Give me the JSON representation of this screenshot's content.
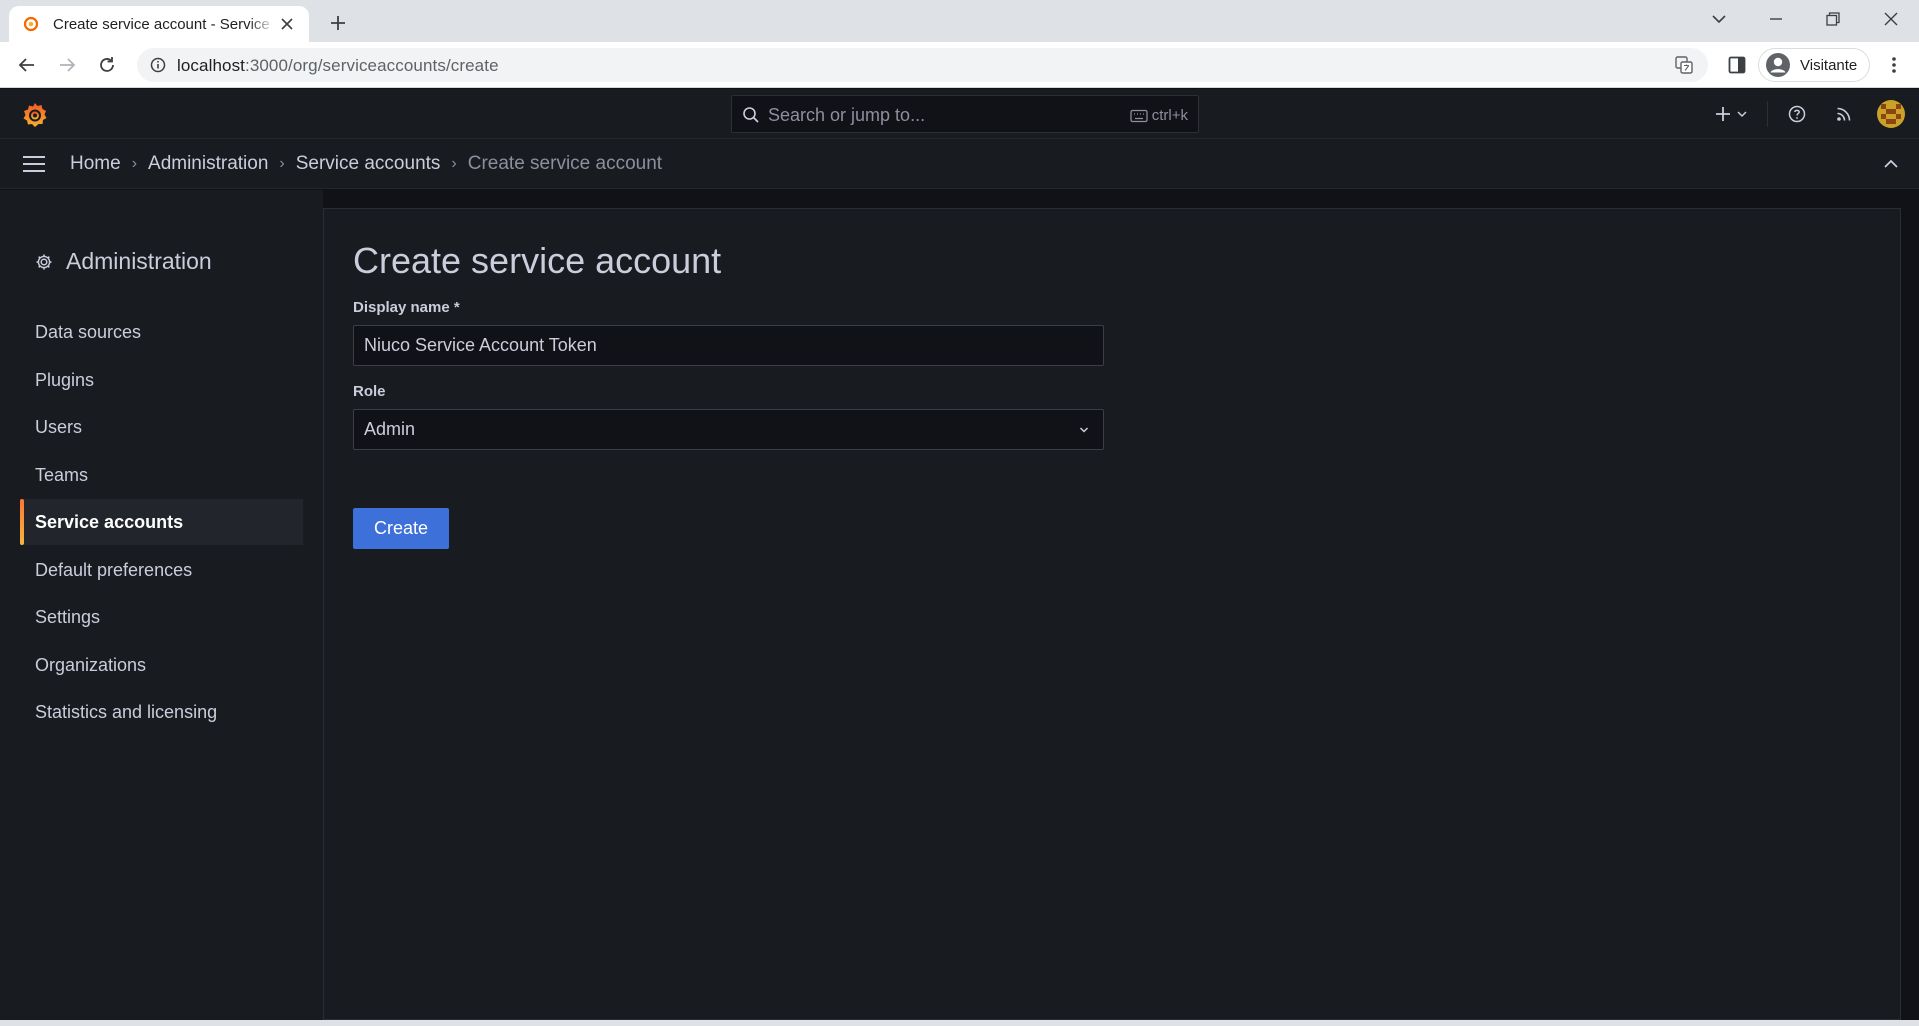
{
  "browser": {
    "tab_title": "Create service account - Service accounts - Administration - Grafana",
    "url_host": "localhost",
    "url_rest": ":3000/org/serviceaccounts/create",
    "profile_name": "Visitante"
  },
  "topbar": {
    "search_placeholder": "Search or jump to...",
    "search_shortcut": "ctrl+k"
  },
  "breadcrumb": {
    "items": [
      "Home",
      "Administration",
      "Service accounts"
    ],
    "current": "Create service account"
  },
  "sidebar": {
    "title": "Administration",
    "items": [
      {
        "label": "Data sources"
      },
      {
        "label": "Plugins"
      },
      {
        "label": "Users"
      },
      {
        "label": "Teams"
      },
      {
        "label": "Service accounts",
        "active": true
      },
      {
        "label": "Default preferences"
      },
      {
        "label": "Settings"
      },
      {
        "label": "Organizations"
      },
      {
        "label": "Statistics and licensing"
      }
    ]
  },
  "form": {
    "title": "Create service account",
    "display_name_label": "Display name *",
    "display_name_value": "Niuco Service Account Token",
    "role_label": "Role",
    "role_value": "Admin",
    "submit_label": "Create"
  },
  "colors": {
    "accent_blue": "#3d71d9",
    "active_indicator": "#ff7538",
    "background": "#111217",
    "panel": "#181b1f"
  }
}
